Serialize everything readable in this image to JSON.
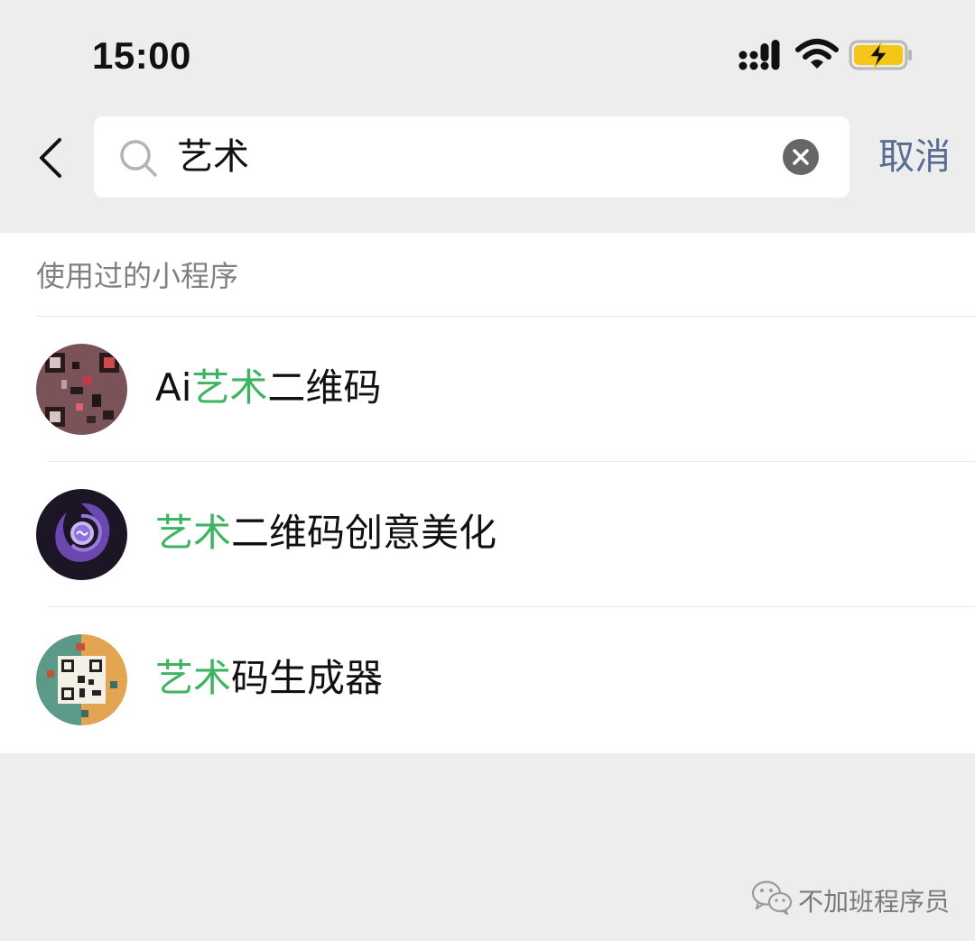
{
  "status_bar": {
    "time": "15:00"
  },
  "search": {
    "query": "艺术",
    "cancel_label": "取消"
  },
  "section": {
    "title": "使用过的小程序"
  },
  "results": [
    {
      "pre": "Ai",
      "hl": "艺术",
      "post": "二维码"
    },
    {
      "pre": "",
      "hl": "艺术",
      "post": "二维码创意美化"
    },
    {
      "pre": "",
      "hl": "艺术",
      "post": "码生成器"
    }
  ],
  "watermark": {
    "text": "不加班程序员"
  },
  "colors": {
    "highlight": "#3cb461",
    "cancel": "#576b95",
    "battery": "#f5c518"
  }
}
